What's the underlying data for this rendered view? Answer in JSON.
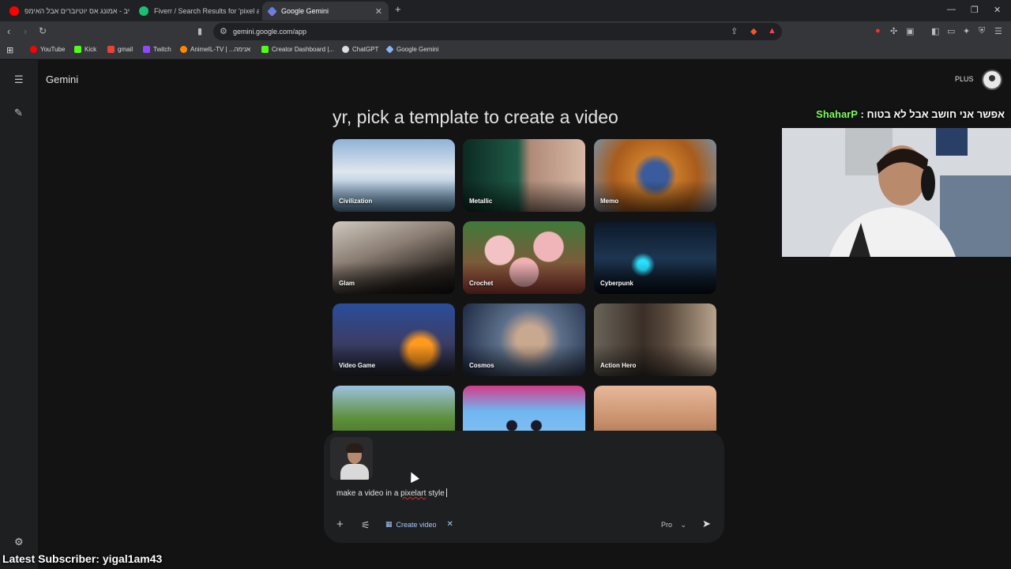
{
  "browser": {
    "tabs": [
      {
        "label": "לייב - אמונג אס יוטיוברים אבל האימפ",
        "favicon": "youtube-icon",
        "color": "#ff0000"
      },
      {
        "label": "Fiverr / Search Results for 'pixel art'",
        "favicon": "fiverr-icon",
        "color": "#1dbf73"
      },
      {
        "label": "Google Gemini",
        "favicon": "gemini-icon",
        "color": "#8ab4f8"
      }
    ],
    "url": "gemini.google.com/app",
    "bookmarks": [
      {
        "label": "YouTube",
        "color": "#ff0000"
      },
      {
        "label": "Kick",
        "color": "#53fc18"
      },
      {
        "label": "gmail",
        "color": "#ea4335"
      },
      {
        "label": "Twitch",
        "color": "#9146ff"
      },
      {
        "label": "AnimeIL-TV | ...אנימה",
        "color": "#ff8800"
      },
      {
        "label": "Creator Dashboard |...",
        "color": "#53fc18"
      },
      {
        "label": "ChatGPT",
        "color": "#dddddd"
      },
      {
        "label": "Google Gemini",
        "color": "#8ab4f8"
      }
    ]
  },
  "app": {
    "brand": "Gemini",
    "plan_badge": "PLUS",
    "heading": "yr, pick a template to create a video",
    "templates": [
      {
        "label": "Civilization"
      },
      {
        "label": "Metallic"
      },
      {
        "label": "Memo"
      },
      {
        "label": "Glam"
      },
      {
        "label": "Crochet"
      },
      {
        "label": "Cyberpunk"
      },
      {
        "label": "Video Game"
      },
      {
        "label": "Cosmos"
      },
      {
        "label": "Action Hero"
      },
      {
        "label": ""
      },
      {
        "label": ""
      },
      {
        "label": ""
      }
    ],
    "composer": {
      "prompt_prefix": "make a video in a ",
      "prompt_misspelled": "pixelart",
      "prompt_suffix": " style",
      "tool_chip": "Create video",
      "model": "Pro"
    }
  },
  "stream": {
    "chat_message": "אפשר אני חושב אבל לא בטוח :",
    "chat_user": "ShaharP",
    "latest_subscriber": "Latest Subscriber: yigal1am43"
  },
  "colors": {
    "accent": "#a8c7fa",
    "background": "#131314",
    "surface": "#1e1f20"
  }
}
